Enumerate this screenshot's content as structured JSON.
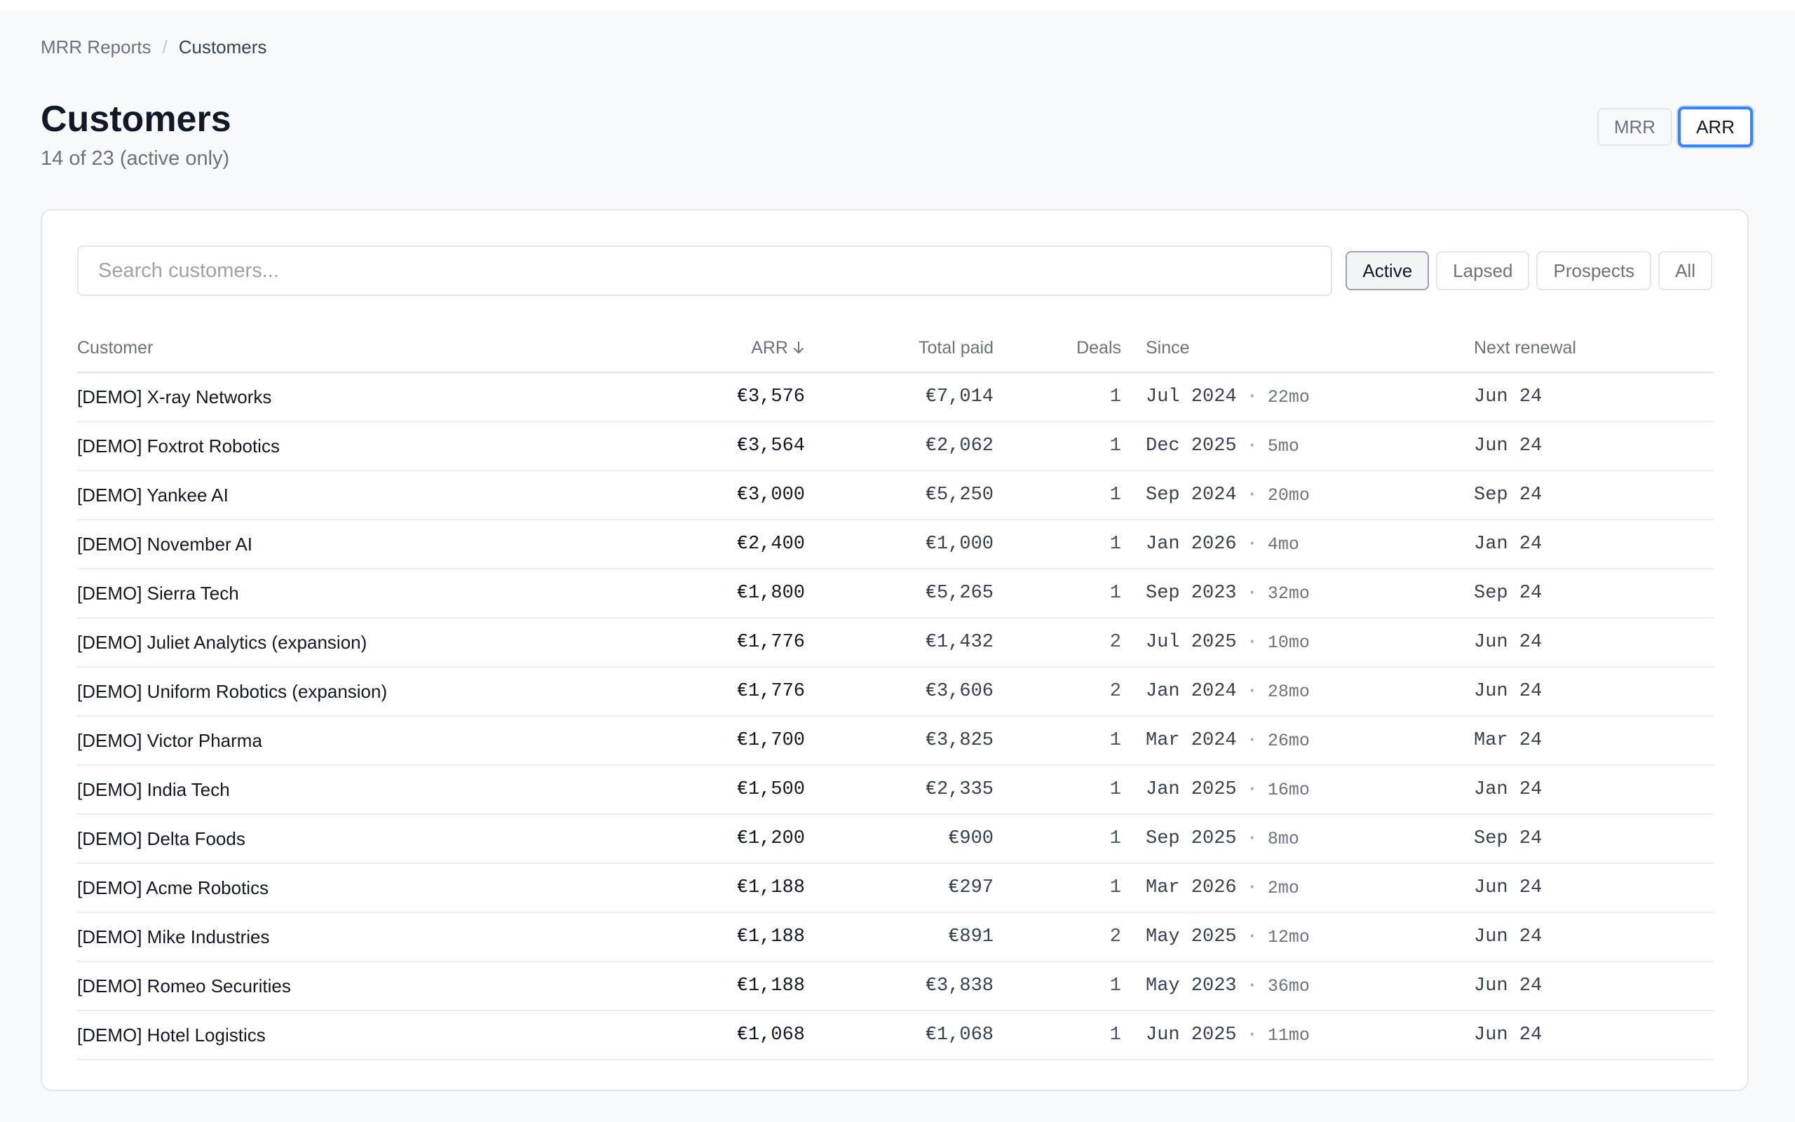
{
  "breadcrumb": {
    "root": "MRR Reports",
    "separator": "/",
    "current": "Customers"
  },
  "header": {
    "title": "Customers",
    "subtitle": "14 of 23 (active only)",
    "view_toggle": {
      "options": [
        "MRR",
        "ARR"
      ],
      "selected": "ARR"
    }
  },
  "search": {
    "placeholder": "Search customers..."
  },
  "filters": {
    "options": [
      "Active",
      "Lapsed",
      "Prospects",
      "All"
    ],
    "selected": "Active"
  },
  "table": {
    "columns": {
      "customer": "Customer",
      "arr": "ARR",
      "total_paid": "Total paid",
      "deals": "Deals",
      "since": "Since",
      "next_renewal": "Next renewal"
    },
    "sort": {
      "column": "ARR",
      "direction": "descending",
      "icon": "arrow-down-icon"
    },
    "rows": [
      {
        "customer": "[DEMO] X-ray Networks",
        "arr": "€3,576",
        "total_paid": "€7,014",
        "deals": "1",
        "since_date": "Jul 2024",
        "since_duration": "22mo",
        "next_renewal": "Jun 24"
      },
      {
        "customer": "[DEMO] Foxtrot Robotics",
        "arr": "€3,564",
        "total_paid": "€2,062",
        "deals": "1",
        "since_date": "Dec 2025",
        "since_duration": "5mo",
        "next_renewal": "Jun 24"
      },
      {
        "customer": "[DEMO] Yankee AI",
        "arr": "€3,000",
        "total_paid": "€5,250",
        "deals": "1",
        "since_date": "Sep 2024",
        "since_duration": "20mo",
        "next_renewal": "Sep 24"
      },
      {
        "customer": "[DEMO] November AI",
        "arr": "€2,400",
        "total_paid": "€1,000",
        "deals": "1",
        "since_date": "Jan 2026",
        "since_duration": "4mo",
        "next_renewal": "Jan 24"
      },
      {
        "customer": "[DEMO] Sierra Tech",
        "arr": "€1,800",
        "total_paid": "€5,265",
        "deals": "1",
        "since_date": "Sep 2023",
        "since_duration": "32mo",
        "next_renewal": "Sep 24"
      },
      {
        "customer": "[DEMO] Juliet Analytics (expansion)",
        "arr": "€1,776",
        "total_paid": "€1,432",
        "deals": "2",
        "since_date": "Jul 2025",
        "since_duration": "10mo",
        "next_renewal": "Jun 24"
      },
      {
        "customer": "[DEMO] Uniform Robotics (expansion)",
        "arr": "€1,776",
        "total_paid": "€3,606",
        "deals": "2",
        "since_date": "Jan 2024",
        "since_duration": "28mo",
        "next_renewal": "Jun 24"
      },
      {
        "customer": "[DEMO] Victor Pharma",
        "arr": "€1,700",
        "total_paid": "€3,825",
        "deals": "1",
        "since_date": "Mar 2024",
        "since_duration": "26mo",
        "next_renewal": "Mar 24"
      },
      {
        "customer": "[DEMO] India Tech",
        "arr": "€1,500",
        "total_paid": "€2,335",
        "deals": "1",
        "since_date": "Jan 2025",
        "since_duration": "16mo",
        "next_renewal": "Jan 24"
      },
      {
        "customer": "[DEMO] Delta Foods",
        "arr": "€1,200",
        "total_paid": "€900",
        "deals": "1",
        "since_date": "Sep 2025",
        "since_duration": "8mo",
        "next_renewal": "Sep 24"
      },
      {
        "customer": "[DEMO] Acme Robotics",
        "arr": "€1,188",
        "total_paid": "€297",
        "deals": "1",
        "since_date": "Mar 2026",
        "since_duration": "2mo",
        "next_renewal": "Jun 24"
      },
      {
        "customer": "[DEMO] Mike Industries",
        "arr": "€1,188",
        "total_paid": "€891",
        "deals": "2",
        "since_date": "May 2025",
        "since_duration": "12mo",
        "next_renewal": "Jun 24"
      },
      {
        "customer": "[DEMO] Romeo Securities",
        "arr": "€1,188",
        "total_paid": "€3,838",
        "deals": "1",
        "since_date": "May 2023",
        "since_duration": "36mo",
        "next_renewal": "Jun 24"
      },
      {
        "customer": "[DEMO] Hotel Logistics",
        "arr": "€1,068",
        "total_paid": "€1,068",
        "deals": "1",
        "since_date": "Jun 2025",
        "since_duration": "11mo",
        "next_renewal": "Jun 24"
      }
    ]
  }
}
